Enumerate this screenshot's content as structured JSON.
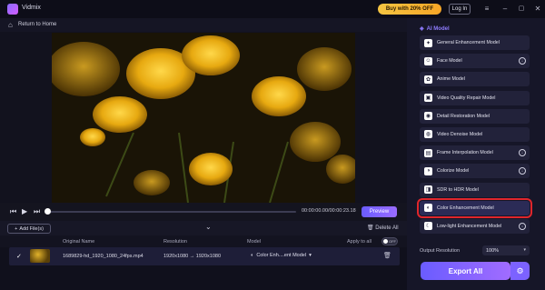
{
  "app": {
    "name": "Vidmix"
  },
  "titlebar": {
    "buy_label": "Buy with 20% OFF",
    "login_label": "Log In",
    "menu_icon": "hamburger-icon",
    "minimize_icon": "minimize-icon",
    "maximize_icon": "maximize-icon",
    "close_icon": "close-icon"
  },
  "nav": {
    "back_label": "Return to Home"
  },
  "player": {
    "time": "00:00:00.00/00:00:23.18",
    "progress": 0,
    "preview_label": "Preview"
  },
  "filebar": {
    "add_label": "Add File(s)",
    "delete_all_label": "Delete All"
  },
  "table": {
    "headers": {
      "original_name": "Original Name",
      "resolution": "Resolution",
      "model": "Model",
      "apply_to_all": "Apply to all",
      "toggle_state": "OFF"
    },
    "rows": [
      {
        "name": "1689829-hd_1920_1080_24fps.mp4",
        "resolution": "1920x1080 → 1920x1080",
        "model": "Color Enh....ent Model"
      }
    ]
  },
  "panel": {
    "header": "AI Model",
    "models": [
      {
        "label": "General Enhancement Model",
        "download": false,
        "selected": false
      },
      {
        "label": "Face Model",
        "download": true,
        "selected": false
      },
      {
        "label": "Anime Model",
        "download": false,
        "selected": false
      },
      {
        "label": "Video Quality Repair Model",
        "download": false,
        "selected": false
      },
      {
        "label": "Detail Restoration Model",
        "download": false,
        "selected": false
      },
      {
        "label": "Video Denoise Model",
        "download": false,
        "selected": false
      },
      {
        "label": "Frame Interpolation Model",
        "download": true,
        "selected": false
      },
      {
        "label": "Colorize Model",
        "download": true,
        "selected": false
      },
      {
        "label": "SDR to HDR Model",
        "download": false,
        "selected": false
      },
      {
        "label": "Color Enhancement Model",
        "download": false,
        "selected": true
      },
      {
        "label": "Low-light Enhancement Model",
        "download": true,
        "selected": false
      }
    ],
    "output_resolution_label": "Output Resolution",
    "output_resolution_value": "100%",
    "export_label": "Export All"
  },
  "colors": {
    "accent": "#7c62ff",
    "highlight": "#e0262c",
    "buy": "#f5c542"
  }
}
